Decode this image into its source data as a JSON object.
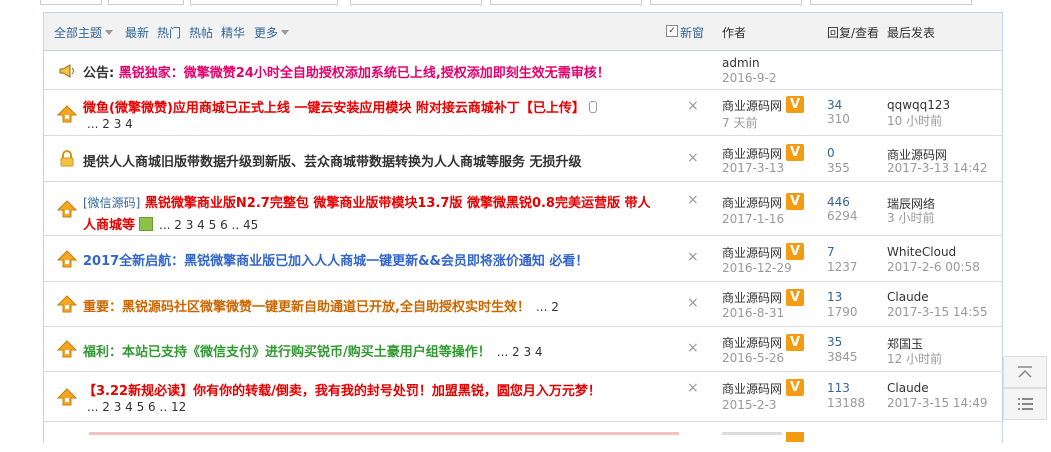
{
  "header": {
    "filter_all": "全部主题",
    "latest": "最新",
    "hot": "热门",
    "hottopic": "热帖",
    "digest": "精华",
    "more": "更多",
    "newwin": "新窗",
    "check_mark": "✓",
    "col_author": "作者",
    "col_replies": "回复/查看",
    "col_last": "最后发表"
  },
  "rows": [
    {
      "type": "notice",
      "prefix": "公告: ",
      "title": "黑锐独家：微擎微赞24小时全自助授权添加系统已上线,授权添加即刻生效无需审核！",
      "title_color": "#e6006e",
      "author": "admin",
      "date": "2016-9-2"
    },
    {
      "title": "微鱼(微擎微赞)应用商城已正式上线 一键云安装应用模块 附对接云商城补丁【已上传】",
      "title_color": "#e60000",
      "pages": "... 2 3 4",
      "author": "商业源码网",
      "date": "7 天前",
      "date_color": "#999",
      "replies": "34",
      "views": "310",
      "lastby": "qqwqq123",
      "lastdate": "10 小时前"
    },
    {
      "title": "提供人人商城旧版带数据升级到新版、芸众商城带数据转换为人人商城等服务 无损升级",
      "title_color": "#333",
      "author": "商业源码网",
      "date": "2017-3-13",
      "replies": "0",
      "views": "355",
      "lastby": "商业源码网",
      "lastdate": "2017-3-13 14:42"
    },
    {
      "tag": "[微信源码]",
      "title_line1": "黑锐微擎商业版N2.7完整包 微擎商业版带模块13.7版 微擎微黑锐0.8完美运营版 带人",
      "title_line2": "人商城等",
      "title_color": "#e60000",
      "pages": "... 2 3 4 5 6 .. 45",
      "author": "商业源码网",
      "date": "2017-1-16",
      "replies": "446",
      "views": "6294",
      "lastby": "瑞辰网络",
      "lastdate": "3 小时前"
    },
    {
      "title": "2017全新启航：黑锐微擎商业版已加入人人商城一键更新&&会员即将涨价通知 必看！",
      "title_color": "#3366cc",
      "author": "商业源码网",
      "date": "2016-12-29",
      "replies": "7",
      "views": "1237",
      "lastby": "WhiteCloud",
      "lastdate": "2017-2-6 00:58"
    },
    {
      "title": "重要：黑锐源码社区微擎微赞一键更新自助通道已开放,全自助授权实时生效！",
      "title_color": "#cc6600",
      "pages": "... 2",
      "author": "商业源码网",
      "date": "2016-8-31",
      "replies": "13",
      "views": "1790",
      "lastby": "Claude",
      "lastdate": "2017-3-15 14:55"
    },
    {
      "title": "福利：本站已支持《微信支付》进行购买锐币/购买土豪用户组等操作！",
      "title_color": "#339933",
      "pages": "... 2 3 4",
      "author": "商业源码网",
      "date": "2016-5-26",
      "replies": "35",
      "views": "3845",
      "lastby": "郑国玉",
      "lastdate": "12 小时前"
    },
    {
      "title": "【3.22新规必读】你有你的转载/倒卖，我有我的封号处罚！加盟黑锐，圆您月入万元梦！",
      "title_color": "#e60000",
      "pages": "... 2 3 4 5 6 .. 12",
      "author": "商业源码网",
      "date": "2015-2-3",
      "replies": "113",
      "views": "13188",
      "lastby": "Claude",
      "lastdate": "2017-3-15 14:49"
    }
  ],
  "icons": {
    "notice": "megaphone-icon",
    "sticky": "arrow-up-icon",
    "lock": "lock-icon",
    "attach": "paperclip-icon",
    "image": "image-icon",
    "close": "close-icon",
    "vip": "v-badge-icon"
  },
  "colors": {
    "accent": "#336699",
    "badge": "#f39c12",
    "sticky": "#f5a623"
  },
  "sidebar": {
    "top_icon": "back-to-top-icon",
    "list_icon": "list-view-icon"
  },
  "vip_letter": "V"
}
